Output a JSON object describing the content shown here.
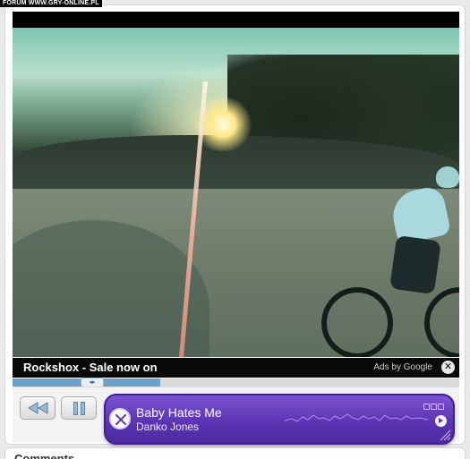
{
  "watermark": {
    "text": "FORUM WWW.GRY-ONLINE.PL"
  },
  "ad": {
    "title": "Rockshox - Sale now on",
    "attribution": "Ads by Google",
    "close_glyph": "✕"
  },
  "player": {
    "progress_fraction": 0.33,
    "handle_glyph": "◂▸",
    "controls": {
      "rewind_icon": "rewind-icon",
      "pause_icon": "pause-icon"
    }
  },
  "now_playing": {
    "title": "Baby Hates Me",
    "artist": "Danko Jones"
  },
  "comments": {
    "title": "Comments"
  },
  "colors": {
    "now_playing_bg": "#5b35b3",
    "progress_fill": "#6aa2cc",
    "ad_bar": "#0a0a0a"
  }
}
